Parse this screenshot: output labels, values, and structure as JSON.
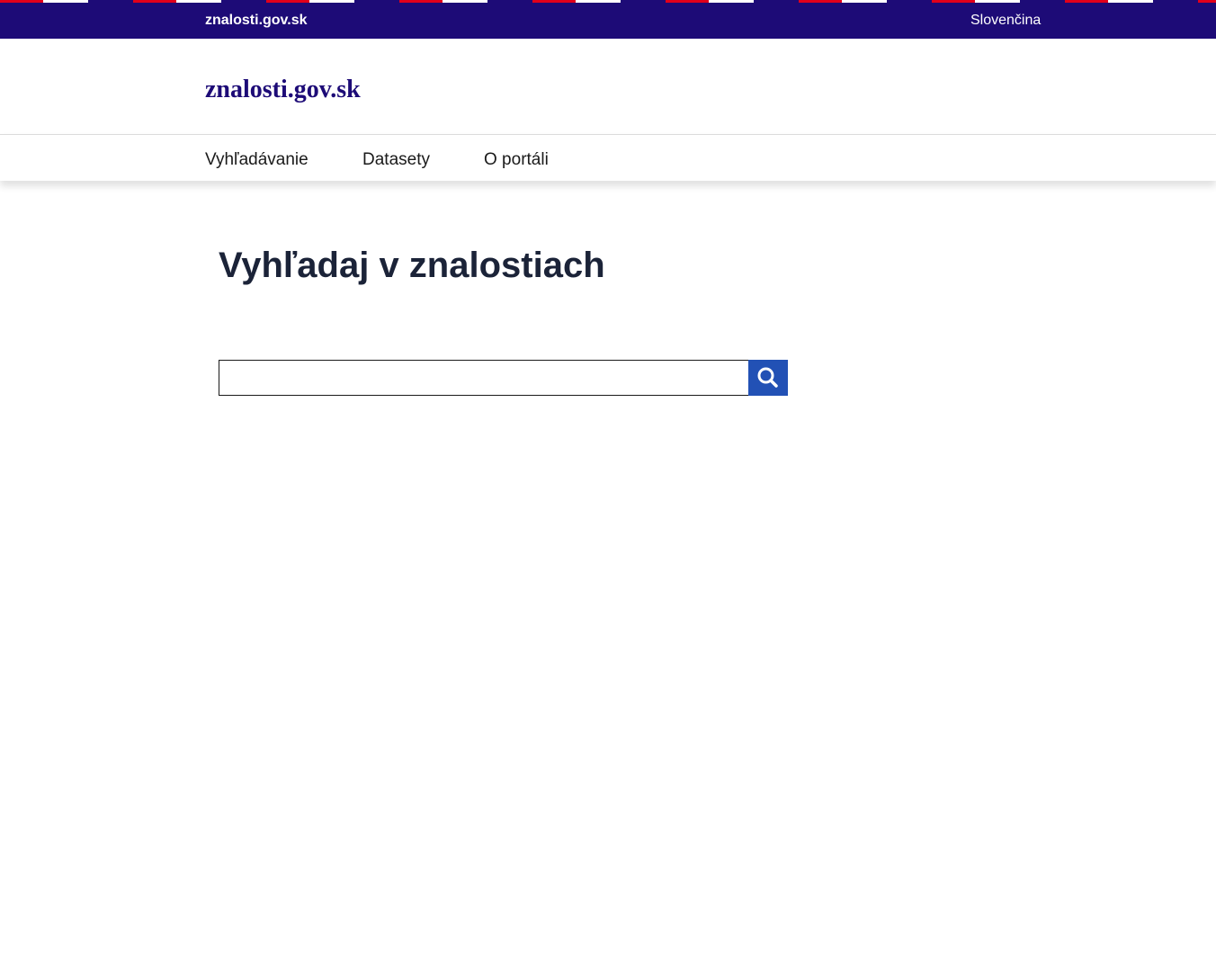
{
  "topbar": {
    "site_name": "znalosti.gov.sk",
    "language": "Slovenčina"
  },
  "header": {
    "brand": "znalosti.gov.sk"
  },
  "nav": {
    "items": [
      {
        "label": "Vyhľadávanie"
      },
      {
        "label": "Datasety"
      },
      {
        "label": "O portáli"
      }
    ]
  },
  "main": {
    "title": "Vyhľadaj v znalostiach",
    "search": {
      "value": "",
      "placeholder": "",
      "button_icon": "search-icon"
    }
  },
  "colors": {
    "topbar": "#1d0b77",
    "flag_red": "#e2001a",
    "flag_white": "#ffffff",
    "brand": "#1d0b77",
    "search_button": "#2251b5",
    "title": "#1b2338"
  }
}
